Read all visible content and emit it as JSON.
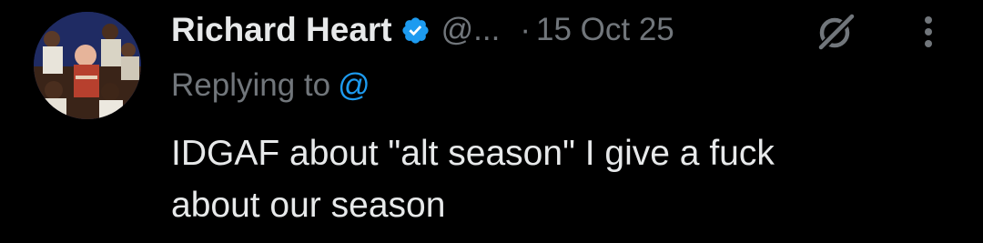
{
  "tweet": {
    "author_name": "Richard Heart",
    "handle": "@...",
    "separator": "·",
    "date": "15 Oct 25",
    "replying_label": "Replying to",
    "replying_mention": "@",
    "text_line_1": "IDGAF about \"alt season\" I give a fuck",
    "text_line_2": "about our season"
  },
  "icons": {
    "verified": "verified-badge-icon",
    "grok": "grok-icon",
    "more": "more-vertical-icon"
  },
  "colors": {
    "background": "#000000",
    "primary_text": "#e7e9ea",
    "secondary_text": "#71767b",
    "accent": "#1d9bf0"
  }
}
